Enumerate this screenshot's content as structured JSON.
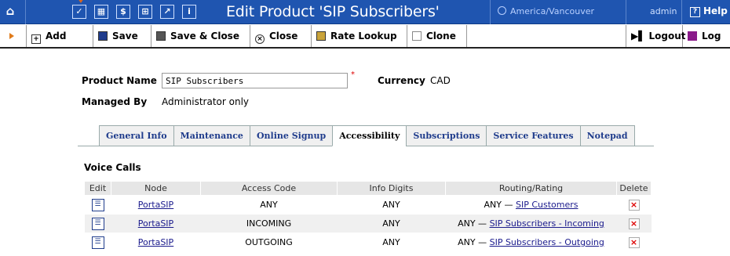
{
  "window": {
    "title": "Edit Product 'SIP Subscribers'",
    "timezone": "America/Vancouver",
    "user": "admin",
    "help": "Help"
  },
  "toolbar": {
    "add": "Add",
    "save": "Save",
    "save_close": "Save & Close",
    "close": "Close",
    "rate_lookup": "Rate Lookup",
    "clone": "Clone",
    "logout": "Logout",
    "log": "Log"
  },
  "form": {
    "product_name_label": "Product Name",
    "product_name_value": "SIP Subscribers",
    "currency_label": "Currency",
    "currency_value": "CAD",
    "managed_by_label": "Managed By",
    "managed_by_value": "Administrator only"
  },
  "tabs": [
    "General Info",
    "Maintenance",
    "Online Signup",
    "Accessibility",
    "Subscriptions",
    "Service Features",
    "Notepad"
  ],
  "active_tab": "Accessibility",
  "voice_calls": {
    "heading": "Voice Calls",
    "columns": [
      "Edit",
      "Node",
      "Access Code",
      "Info Digits",
      "Routing/Rating",
      "Delete"
    ],
    "rows": [
      {
        "node": "PortaSIP",
        "access_code": "ANY",
        "info_digits": "ANY",
        "routing_prefix": "ANY —",
        "routing_link": "SIP Customers"
      },
      {
        "node": "PortaSIP",
        "access_code": "INCOMING",
        "info_digits": "ANY",
        "routing_prefix": "ANY —",
        "routing_link": "SIP Subscribers - Incoming"
      },
      {
        "node": "PortaSIP",
        "access_code": "OUTGOING",
        "info_digits": "ANY",
        "routing_prefix": "ANY —",
        "routing_link": "SIP Subscribers - Outgoing"
      }
    ]
  },
  "colors": {
    "title_bar": "#1f55b0",
    "link": "#1a1a8c",
    "delete": "#dd0000"
  }
}
